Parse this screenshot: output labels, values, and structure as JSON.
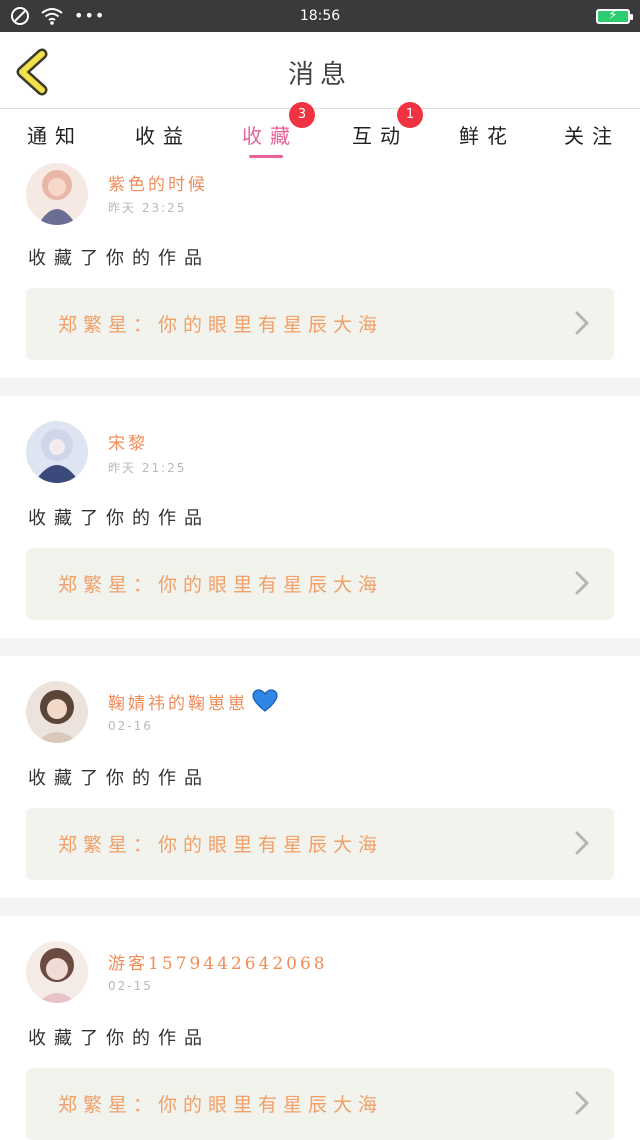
{
  "status_bar": {
    "time": "18:56",
    "dots": "•••"
  },
  "header": {
    "title": "消息"
  },
  "tabs": [
    {
      "label": "通知"
    },
    {
      "label": "收益"
    },
    {
      "label": "收藏",
      "badge": "3"
    },
    {
      "label": "互动",
      "badge": "1"
    },
    {
      "label": "鲜花"
    },
    {
      "label": "关注"
    }
  ],
  "feed": [
    {
      "username": "紫色的时候",
      "time": "昨天 23:25",
      "action": "收藏了你的作品",
      "work_title": "郑繁星：你的眼里有星辰大海",
      "avatar_colors": [
        "#e9b7a8",
        "#6a6e95"
      ]
    },
    {
      "username": "宋黎",
      "time": "昨天 21:25",
      "action": "收藏了你的作品",
      "work_title": "郑繁星：你的眼里有星辰大海",
      "avatar_colors": [
        "#cfd6ea",
        "#3b4a7a"
      ]
    },
    {
      "username": "鞠婧祎的鞠崽崽",
      "time": "02-16",
      "action": "收藏了你的作品",
      "work_title": "郑繁星：你的眼里有星辰大海",
      "avatar_colors": [
        "#d9c9bd",
        "#5b4438"
      ]
    },
    {
      "username": "游客1579442642068",
      "time": "02-15",
      "action": "收藏了你的作品",
      "work_title": "郑繁星：你的眼里有星辰大海",
      "avatar_colors": [
        "#f0dcd5",
        "#6b4a40"
      ]
    }
  ],
  "colors": {
    "accent": "#e8629a",
    "badge": "#ef3340",
    "username": "#f08c5a",
    "work_title": "#f0a068",
    "battery": "#2ecc71"
  }
}
